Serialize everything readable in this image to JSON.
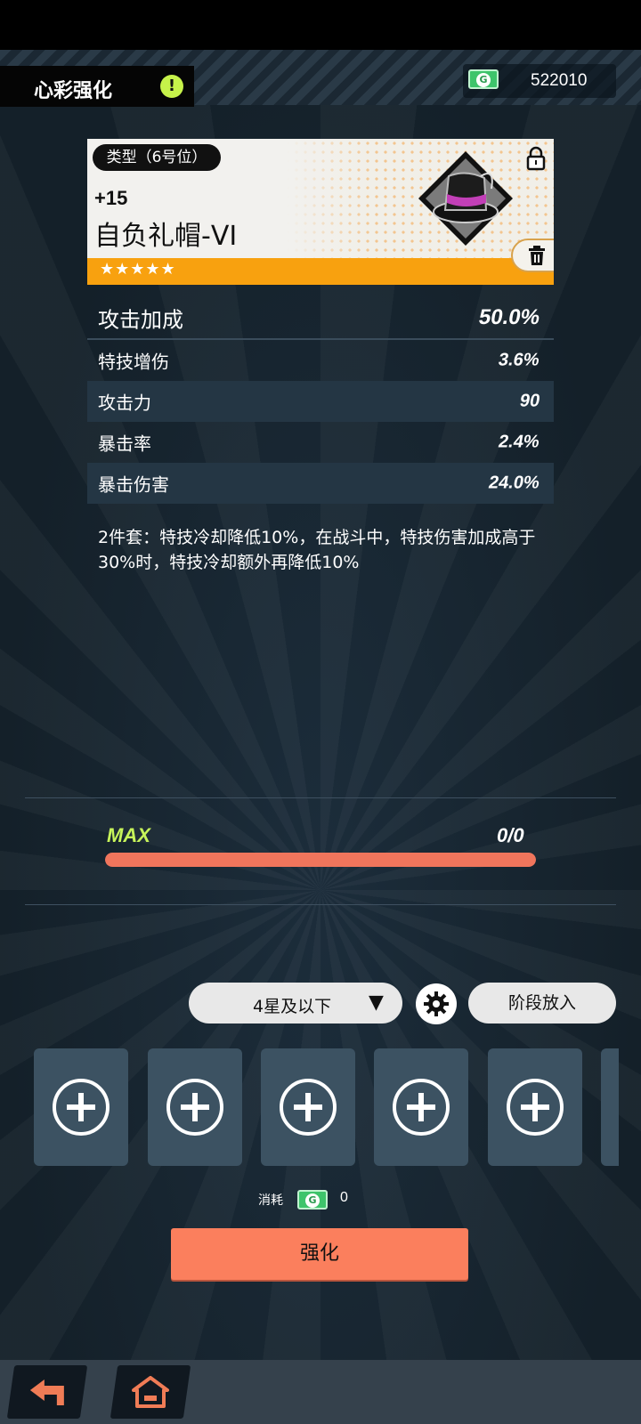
{
  "header": {
    "title": "心彩强化",
    "info_icon_label": "!",
    "currency_value": "522010",
    "currency_icon": "G"
  },
  "item": {
    "type": "类型（6号位）",
    "level": "+15",
    "name": "自负礼帽-VI",
    "stars": "★★★★★",
    "main_stat": {
      "label": "攻击加成",
      "value": "50.0%"
    },
    "sub_stats": [
      {
        "label": "特技增伤",
        "value": "3.6%"
      },
      {
        "label": "攻击力",
        "value": "90"
      },
      {
        "label": "暴击率",
        "value": "2.4%"
      },
      {
        "label": "暴击伤害",
        "value": "24.0%"
      }
    ],
    "set_description": "2件套：特技冷却降低10%，在战斗中，特技伤害加成高于30%时，特技冷却额外再降低10%"
  },
  "progress": {
    "level_label": "MAX",
    "exp_text": "0/0",
    "fill": 1.0,
    "color": "#f0755c"
  },
  "controls": {
    "filter_label": "4星及以下",
    "filter_arrow": "▼",
    "stage_button": "阶段放入"
  },
  "cost": {
    "label": "消耗",
    "value": "0"
  },
  "enhance_button": "强化",
  "colors": {
    "accent": "#fb7f5d",
    "rarity": "#f8a10f",
    "max": "#c7f45a"
  }
}
